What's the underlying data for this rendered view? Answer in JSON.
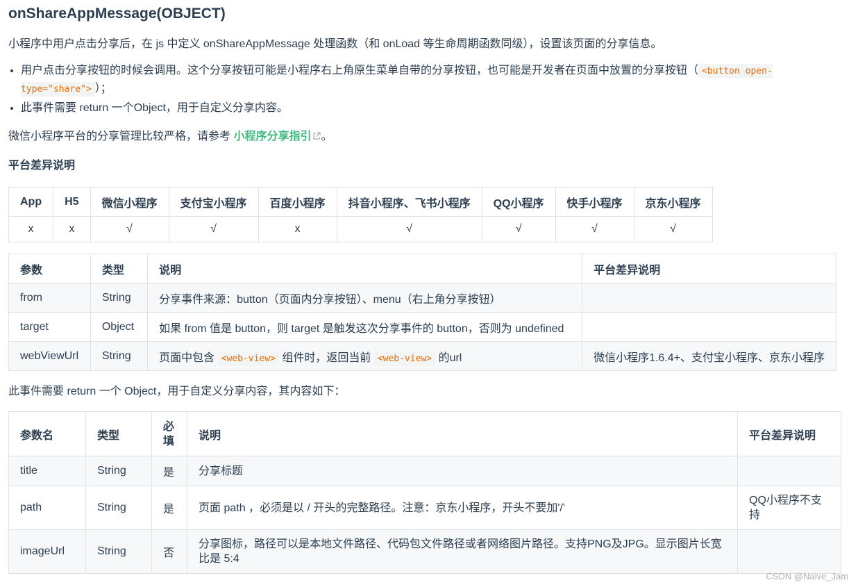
{
  "heading": "onShareAppMessage(OBJECT)",
  "intro": "小程序中用户点击分享后，在 js 中定义 onShareAppMessage 处理函数（和 onLoad 等生命周期函数同级），设置该页面的分享信息。",
  "bullets": {
    "b1_text": "用户点击分享按钮的时候会调用。这个分享按钮可能是小程序右上角原生菜单自带的分享按钮，也可能是开发者在页面中放置的分享按钮（",
    "b1_code": "<button open-type=\"share\">",
    "b1_end": "）；",
    "b2_text": "此事件需要 return 一个Object，用于自定义分享内容。"
  },
  "guide": {
    "before": "微信小程序平台的分享管理比较严格，请参考",
    "link": "小程序分享指引",
    "after": "。",
    "icon": "external-link-icon"
  },
  "platform_heading": "平台差异说明",
  "platform_table": {
    "headers": [
      "App",
      "H5",
      "微信小程序",
      "支付宝小程序",
      "百度小程序",
      "抖音小程序、飞书小程序",
      "QQ小程序",
      "快手小程序",
      "京东小程序"
    ],
    "values": [
      "x",
      "x",
      "√",
      "√",
      "x",
      "√",
      "√",
      "√",
      "√"
    ]
  },
  "params_table": {
    "headers": [
      "参数",
      "类型",
      "说明",
      "平台差异说明"
    ],
    "rows": [
      {
        "name": "from",
        "type": "String",
        "desc": "分享事件来源：button（页面内分享按钮）、menu（右上角分享按钮）",
        "platform": ""
      },
      {
        "name": "target",
        "type": "Object",
        "desc": "如果 from 值是 button，则 target 是触发这次分享事件的 button，否则为 undefined",
        "platform": ""
      },
      {
        "name": "webViewUrl",
        "type": "String",
        "desc_1": "页面中包含",
        "code_1": "<web-view>",
        "desc_2": "组件时，返回当前",
        "code_2": "<web-view>",
        "desc_3": "的url",
        "platform": "微信小程序1.6.4+、支付宝小程序、京东小程序"
      }
    ]
  },
  "return_intro": "此事件需要 return 一个 Object，用于自定义分享内容，其内容如下：",
  "return_table": {
    "headers": [
      "参数名",
      "类型",
      "必填",
      "说明",
      "平台差异说明"
    ],
    "rows": [
      {
        "name": "title",
        "type": "String",
        "required": "是",
        "desc": "分享标题",
        "platform": ""
      },
      {
        "name": "path",
        "type": "String",
        "required": "是",
        "desc": "页面 path ，必须是以 / 开头的完整路径。注意：京东小程序，开头不要加'/'",
        "platform": "QQ小程序不支持"
      },
      {
        "name": "imageUrl",
        "type": "String",
        "required": "否",
        "desc": "分享图标，路径可以是本地文件路径、代码包文件路径或者网络图片路径。支持PNG及JPG。显示图片长宽比是 5:4",
        "platform": ""
      }
    ]
  },
  "watermark": "CSDN @Naive_Jam"
}
